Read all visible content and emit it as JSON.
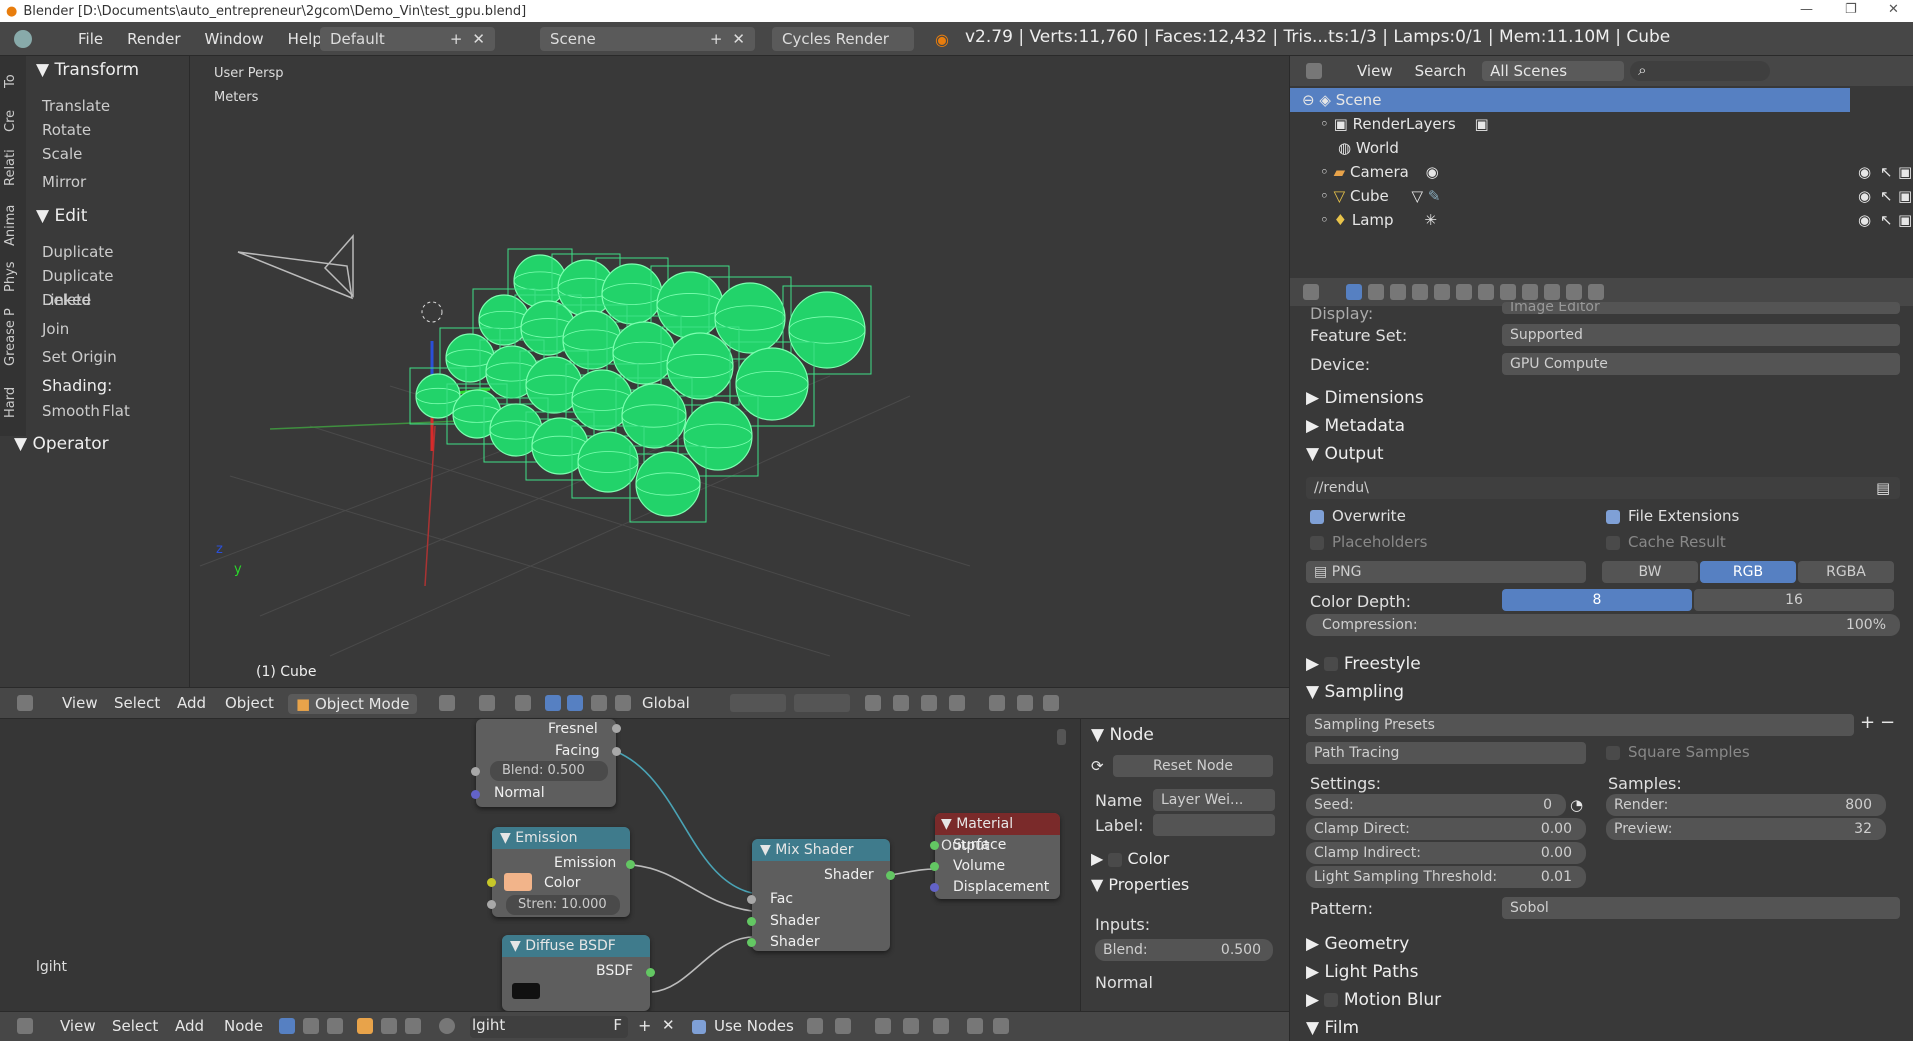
{
  "titlebar": {
    "text": "Blender [D:\\Documents\\auto_entrepreneur\\2gcom\\Demo_Vin\\test_gpu.blend]"
  },
  "menu": {
    "file": "File",
    "render": "Render",
    "window": "Window",
    "help": "Help",
    "layout": "Default",
    "scene": "Scene",
    "engine": "Cycles Render",
    "stats": "v2.79 | Verts:11,760 | Faces:12,432 | Tris...ts:1/3 | Lamps:0/1 | Mem:11.10M | Cube"
  },
  "tools": {
    "tabs": [
      "To",
      "Cre",
      "Relati",
      "Anima",
      "Phys",
      "Grease P",
      "Hard"
    ],
    "transform": "Transform",
    "translate": "Translate",
    "rotate": "Rotate",
    "scale": "Scale",
    "mirror": "Mirror",
    "edit": "Edit",
    "duplicate": "Duplicate",
    "duplicate_linked": "Duplicate Linked",
    "delete": "Delete",
    "join": "Join",
    "set_origin": "Set Origin",
    "shading": "Shading:",
    "smooth": "Smooth",
    "flat": "Flat",
    "operator": "Operator"
  },
  "viewport": {
    "view_name": "User Persp",
    "units": "Meters",
    "object_label": "(1) Cube",
    "axis_y": "y",
    "axis_z": "z"
  },
  "vtoolbar": {
    "view": "View",
    "select": "Select",
    "add": "Add",
    "object": "Object",
    "mode": "Object Mode",
    "orientation": "Global"
  },
  "nodes": {
    "fresnel": {
      "title": "Fresnel",
      "facing": "Facing",
      "blend": "Blend:",
      "blend_val": "0.500",
      "normal": "Normal"
    },
    "emission": {
      "title": "Emission",
      "out": "Emission",
      "color": "Color",
      "strength": "Stren:",
      "strength_val": "10.000",
      "swatch": "#f2b48a"
    },
    "mix": {
      "title": "Mix Shader",
      "shader_out": "Shader",
      "fac": "Fac",
      "shader1": "Shader",
      "shader2": "Shader"
    },
    "output": {
      "title": "Material Output",
      "surface": "Surface",
      "volume": "Volume",
      "displacement": "Displacement"
    },
    "diffuse": {
      "title": "Diffuse BSDF",
      "bsdf": "BSDF"
    },
    "material_label": "lgiht"
  },
  "nodeprops": {
    "node": "Node",
    "reset": "Reset Node",
    "name_label": "Name",
    "name_val": "Layer Wei...",
    "label_label": "Label:",
    "color": "Color",
    "properties": "Properties",
    "inputs": "Inputs:",
    "blend": "Blend:",
    "blend_val": "0.500",
    "normal": "Normal"
  },
  "nodebar": {
    "view": "View",
    "select": "Select",
    "add": "Add",
    "node": "Node",
    "material": "lgiht",
    "fake": "F",
    "use_nodes": "Use Nodes"
  },
  "outliner": {
    "view": "View",
    "search": "Search",
    "filter": "All Scenes",
    "items": [
      "Scene",
      "RenderLayers",
      "World",
      "Camera",
      "Cube",
      "Lamp"
    ]
  },
  "props": {
    "display_label": "Display:",
    "display_val": "Image Editor",
    "feature_set_label": "Feature Set:",
    "feature_set_val": "Supported",
    "device_label": "Device:",
    "device_val": "GPU Compute",
    "dimensions": "Dimensions",
    "metadata": "Metadata",
    "output": "Output",
    "path": "//rendu\\",
    "overwrite": "Overwrite",
    "file_ext": "File Extensions",
    "placeholders": "Placeholders",
    "cache": "Cache Result",
    "format": "PNG",
    "bw": "BW",
    "rgb": "RGB",
    "rgba": "RGBA",
    "depth_label": "Color Depth:",
    "depth_8": "8",
    "depth_16": "16",
    "compression_label": "Compression:",
    "compression_val": "100%",
    "freestyle": "Freestyle",
    "sampling": "Sampling",
    "presets": "Sampling Presets",
    "integrator": "Path Tracing",
    "square": "Square Samples",
    "settings": "Settings:",
    "samples": "Samples:",
    "seed_label": "Seed:",
    "seed_val": "0",
    "clamp_direct": "Clamp Direct:",
    "clamp_direct_val": "0.00",
    "clamp_indirect": "Clamp Indirect:",
    "clamp_indirect_val": "0.00",
    "lst": "Light Sampling Threshold:",
    "lst_val": "0.01",
    "render_label": "Render:",
    "render_val": "800",
    "preview_label": "Preview:",
    "preview_val": "32",
    "pattern_label": "Pattern:",
    "pattern_val": "Sobol",
    "geometry": "Geometry",
    "light_paths": "Light Paths",
    "motion_blur": "Motion Blur",
    "film": "Film"
  }
}
